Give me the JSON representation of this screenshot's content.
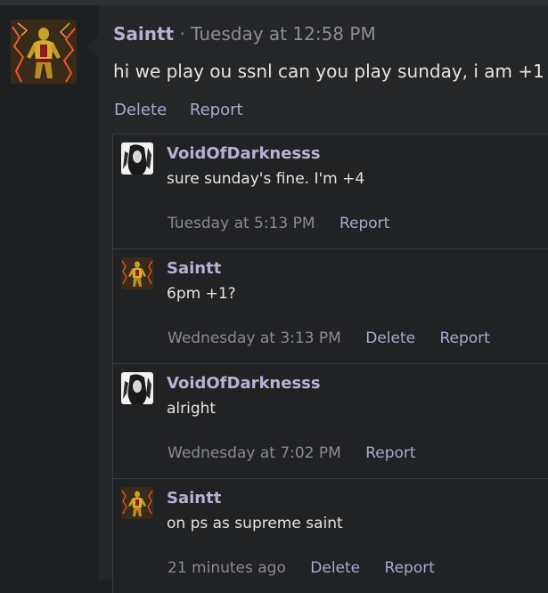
{
  "post": {
    "author": "Saintt",
    "separator": "·",
    "date": "Tuesday at 12:58 PM",
    "message": "hi we play ou ssnl can you play sunday, i am +1",
    "actions": {
      "delete": "Delete",
      "report": "Report"
    }
  },
  "comments": [
    {
      "author": "VoidOfDarknesss",
      "avatar": "void-avatar",
      "text": "sure sunday's fine. I'm +4",
      "date": "Tuesday at 5:13 PM",
      "delete": null,
      "report": "Report"
    },
    {
      "author": "Saintt",
      "avatar": "saintt-avatar",
      "text": "6pm +1?",
      "date": "Wednesday at 3:13 PM",
      "delete": "Delete",
      "report": "Report"
    },
    {
      "author": "VoidOfDarknesss",
      "avatar": "void-avatar",
      "text": "alright",
      "date": "Wednesday at 7:02 PM",
      "delete": null,
      "report": "Report"
    },
    {
      "author": "Saintt",
      "avatar": "saintt-avatar",
      "text": "on ps as supreme saint",
      "date": "21 minutes ago",
      "delete": "Delete",
      "report": "Report"
    }
  ],
  "colors": {
    "background": "#1e1f21",
    "panel": "#252628",
    "username": "#b7b1d3",
    "link": "#a9a8d0",
    "text": "#e4e4e4",
    "muted": "#8d8e91"
  }
}
